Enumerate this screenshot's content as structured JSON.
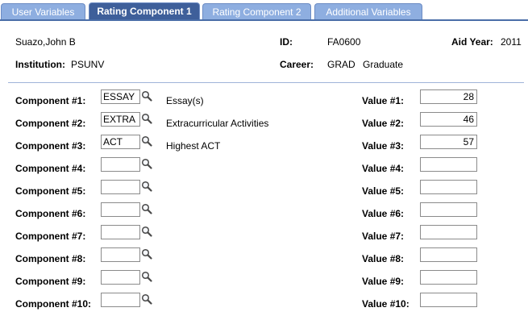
{
  "tabs": [
    {
      "label": "User Variables",
      "active": false
    },
    {
      "label": "Rating Component 1",
      "active": true
    },
    {
      "label": "Rating Component 2",
      "active": false
    },
    {
      "label": "Additional Variables",
      "active": false
    }
  ],
  "header": {
    "name": "Suazo,John B",
    "id_label": "ID:",
    "id_value": "FA0600",
    "aid_year_label": "Aid Year:",
    "aid_year_value": "2011",
    "institution_label": "Institution:",
    "institution_value": "PSUNV",
    "career_label": "Career:",
    "career_code": "GRAD",
    "career_desc": "Graduate"
  },
  "components": [
    {
      "label": "Component #1:",
      "code": "ESSAY",
      "desc": "Essay(s)",
      "value_label": "Value #1:",
      "value": "28"
    },
    {
      "label": "Component #2:",
      "code": "EXTRA",
      "desc": "Extracurricular Activities",
      "value_label": "Value #2:",
      "value": "46"
    },
    {
      "label": "Component #3:",
      "code": "ACT",
      "desc": "Highest ACT",
      "value_label": "Value #3:",
      "value": "57"
    },
    {
      "label": "Component #4:",
      "code": "",
      "desc": "",
      "value_label": "Value #4:",
      "value": ""
    },
    {
      "label": "Component #5:",
      "code": "",
      "desc": "",
      "value_label": "Value #5:",
      "value": ""
    },
    {
      "label": "Component #6:",
      "code": "",
      "desc": "",
      "value_label": "Value #6:",
      "value": ""
    },
    {
      "label": "Component #7:",
      "code": "",
      "desc": "",
      "value_label": "Value #7:",
      "value": ""
    },
    {
      "label": "Component #8:",
      "code": "",
      "desc": "",
      "value_label": "Value #8:",
      "value": ""
    },
    {
      "label": "Component #9:",
      "code": "",
      "desc": "",
      "value_label": "Value #9:",
      "value": ""
    },
    {
      "label": "Component #10:",
      "code": "",
      "desc": "",
      "value_label": "Value #10:",
      "value": ""
    }
  ],
  "icons": {
    "lookup": "magnifier-lookup-icon"
  },
  "colors": {
    "active_tab": "#3e5f9a",
    "inactive_tab": "#8eaee0",
    "tab_line": "#4a6ea8",
    "divider": "#9fb4d8"
  }
}
